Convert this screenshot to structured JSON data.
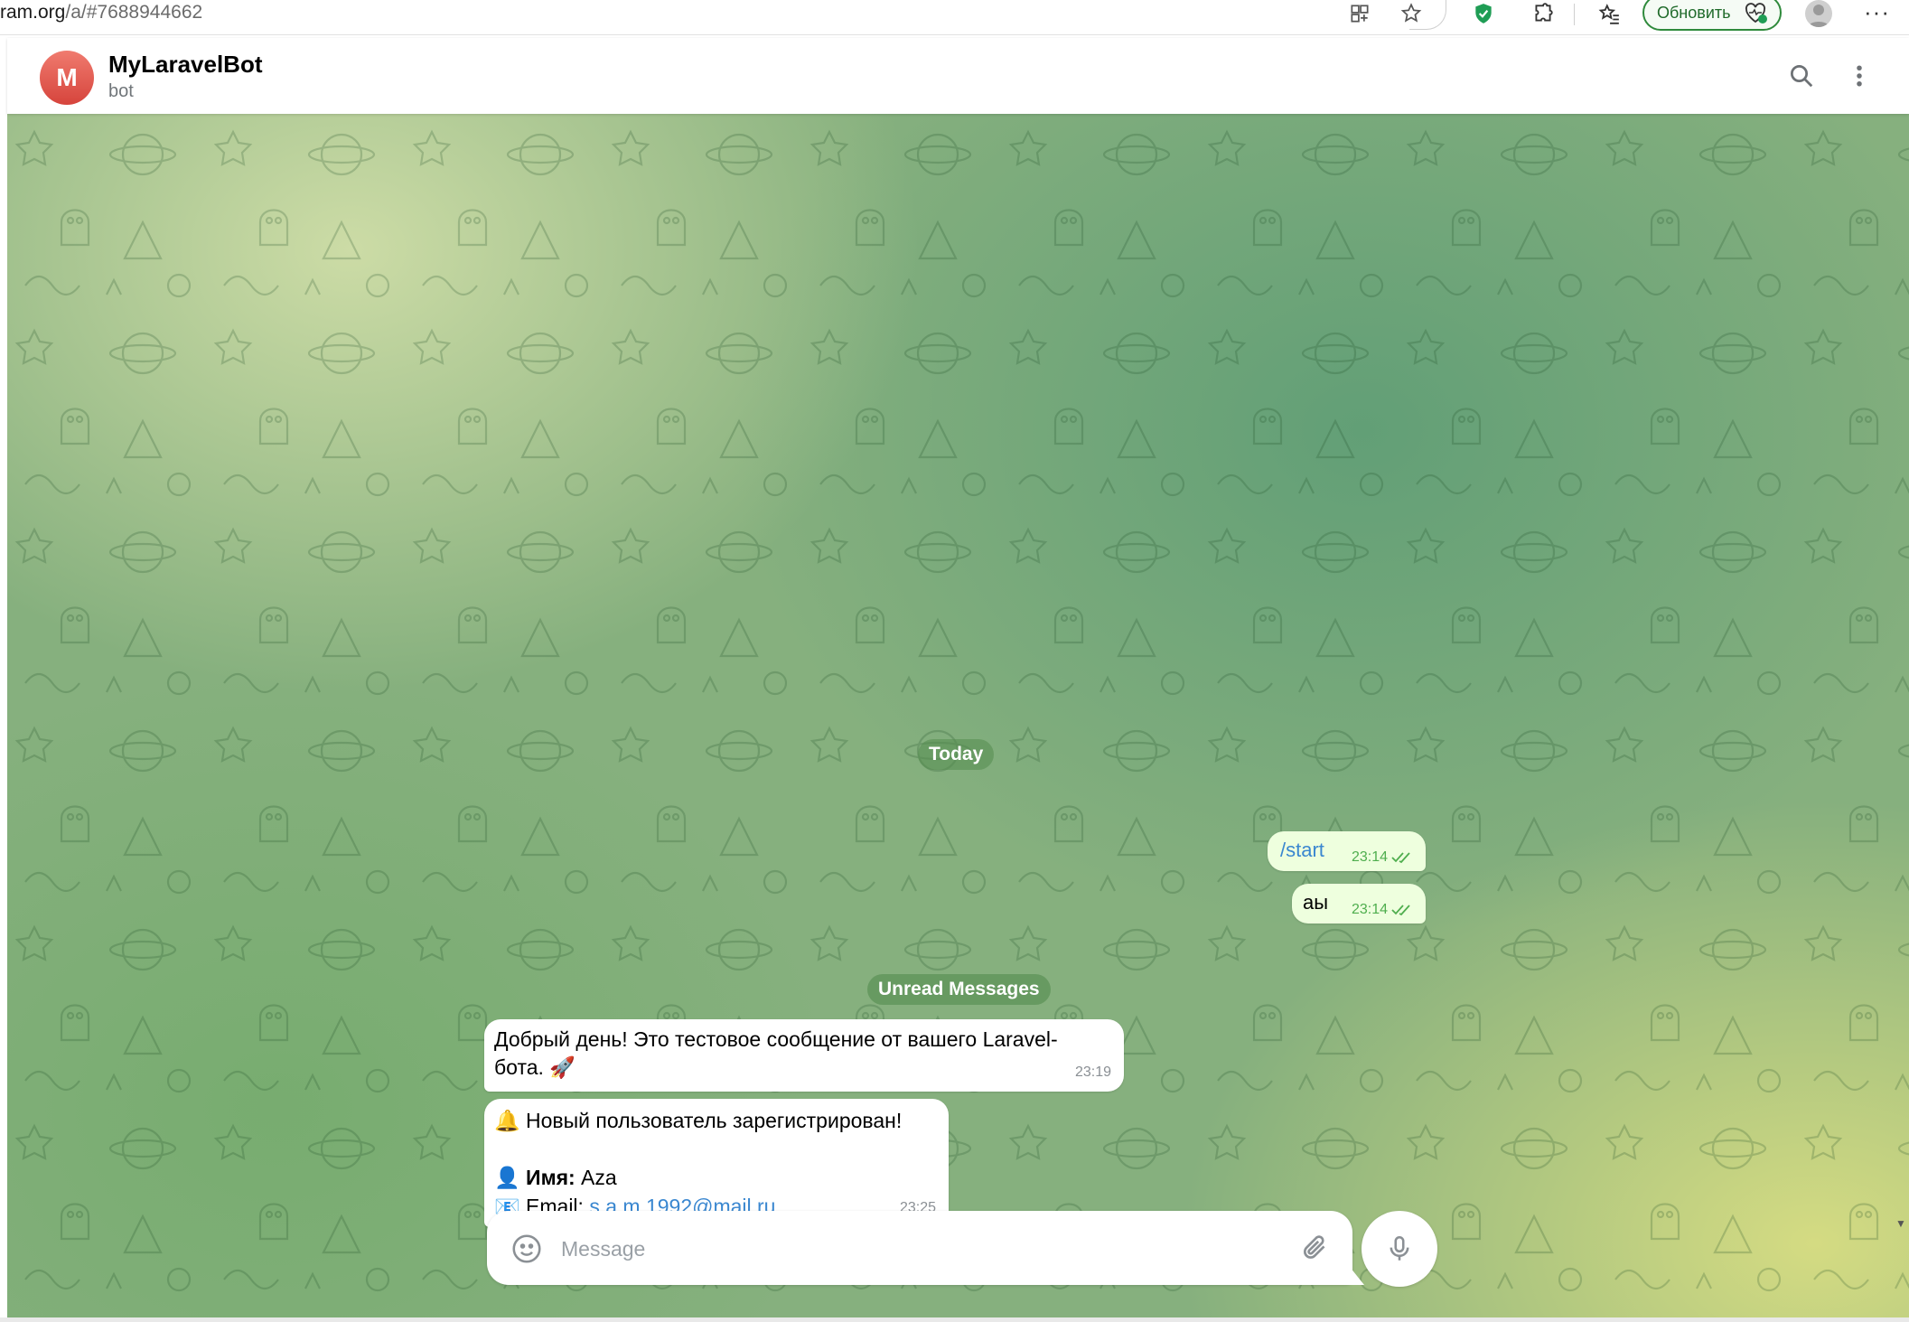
{
  "browser": {
    "url_host": "ram.org",
    "url_path": "/a/#7688944662",
    "update_label": "Обновить",
    "icons": [
      "grid-icon",
      "star-icon",
      "shield-icon",
      "puzzle-icon",
      "favorites-icon",
      "heart-badge-icon",
      "profile-icon",
      "more-icon"
    ]
  },
  "chat": {
    "avatar_letter": "M",
    "title": "MyLaravelBot",
    "subtitle": "bot"
  },
  "messages": {
    "date_label": "Today",
    "unread_label": "Unread Messages",
    "outgoing": [
      {
        "text": "/start",
        "time": "23:14"
      },
      {
        "text": "аы",
        "time": "23:14"
      }
    ],
    "incoming": [
      {
        "line1": "Добрый день! Это тестовое сообщение от вашего Laravel-",
        "line2": "бота. 🚀",
        "time": "23:19"
      },
      {
        "line1": "🔔 Новый пользователь зарегистрирован!",
        "name_prefix": "👤 ",
        "name_label": "Имя:",
        "name_value": " Aza",
        "email_prefix": "📧 Email: ",
        "email_value": "s.a.m.1992@mail.ru",
        "time": "23:25"
      }
    ]
  },
  "composer": {
    "placeholder": "Message"
  },
  "colors": {
    "outgoing_bubble": "#eeffde",
    "incoming_bubble": "#ffffff",
    "link": "#3a87d0",
    "avatar": "#d6443c",
    "update_button": "#2f8a3c"
  }
}
